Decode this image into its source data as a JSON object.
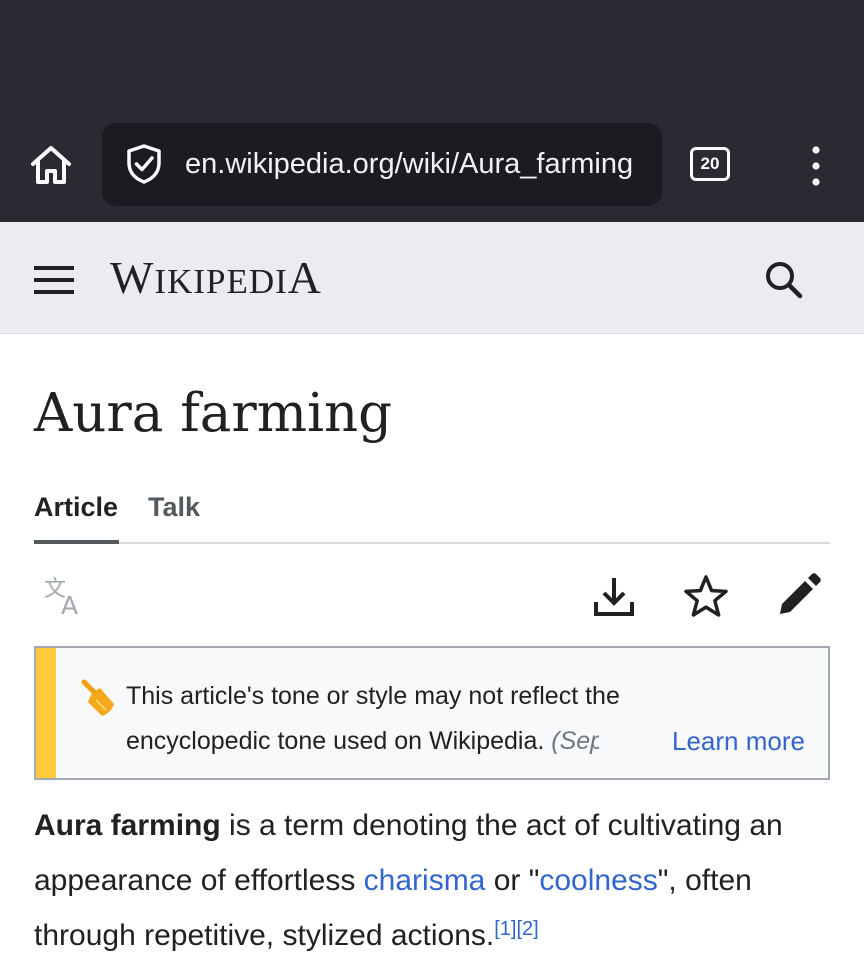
{
  "browser": {
    "url": "en.wikipedia.org/wiki/Aura_farming",
    "tab_count": "20",
    "icons": [
      "home-icon",
      "shield-check-icon",
      "tab-counter-icon",
      "overflow-menu-icon"
    ]
  },
  "wiki_header": {
    "logo_initial": "W",
    "logo_rest": "IKIPEDI",
    "logo_final": "A",
    "icons": [
      "hamburger-menu-icon",
      "search-icon"
    ]
  },
  "article": {
    "title": "Aura farming",
    "tabs": [
      {
        "label": "Article",
        "selected": true
      },
      {
        "label": "Talk",
        "selected": false
      }
    ],
    "action_icons": [
      "language-icon",
      "download-icon",
      "star-icon",
      "edit-pencil-icon"
    ],
    "notice": {
      "line1": "This article's tone or style may not reflect the",
      "line2": "encyclopedic tone used on Wikipedia.",
      "date_fragment": "(Sep",
      "learn_more": "Learn more",
      "accent_color": "#fec93d",
      "icon": "broom-icon"
    },
    "lead": {
      "term": "Aura farming",
      "text1": " is a term denoting the act of cultivating an appearance of effortless ",
      "link1": "charisma",
      "text2": " or \"",
      "link2": "coolness",
      "text3": "\", often through repetitive, stylized actions.",
      "ref1": "[1]",
      "ref2": "[2]",
      "link_color": "#3366cc"
    }
  }
}
